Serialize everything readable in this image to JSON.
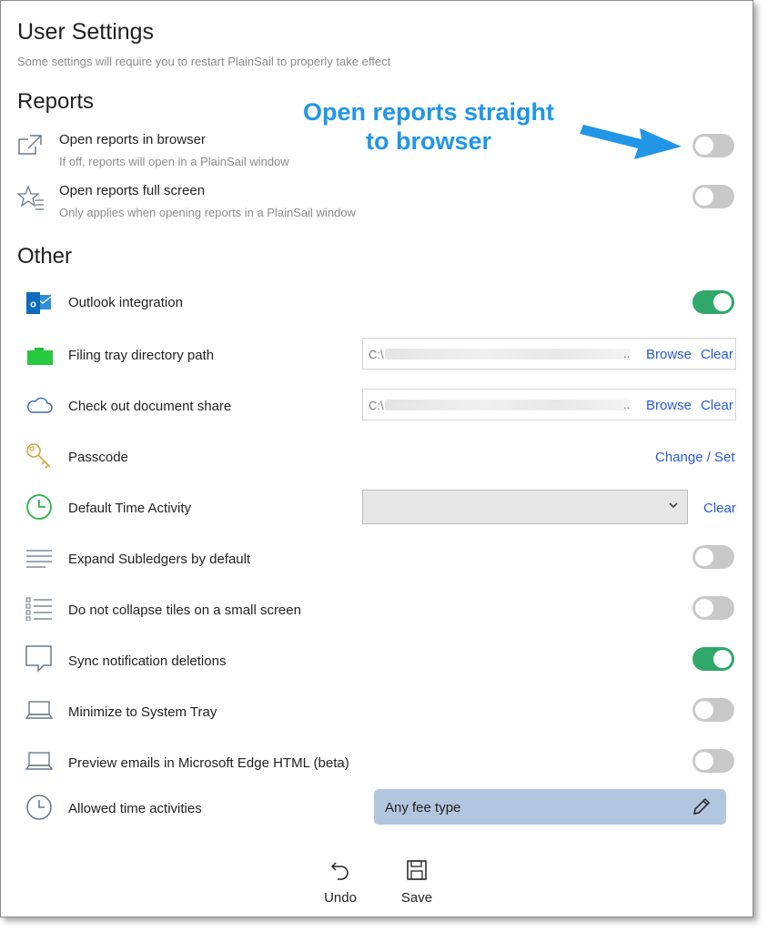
{
  "header": {
    "title": "User Settings",
    "subtitle": "Some settings will require you to restart PlainSail to properly take effect"
  },
  "annotation": {
    "line1": "Open reports straight",
    "line2": "to browser",
    "color": "#2196e6"
  },
  "sections": {
    "reports": "Reports",
    "other": "Other"
  },
  "reports": {
    "open_in_browser": {
      "label": "Open reports in browser",
      "sub": "If off, reports will open in a PlainSail window",
      "on": false
    },
    "full_screen": {
      "label": "Open reports full screen",
      "sub": "Only applies when opening reports in a PlainSail window",
      "on": false
    }
  },
  "other": {
    "outlook": {
      "label": "Outlook integration",
      "on": true
    },
    "filing_tray": {
      "label": "Filing tray directory path",
      "value": "C:\\",
      "browse": "Browse",
      "clear": "Clear"
    },
    "checkout": {
      "label": "Check out document share",
      "value": "C:\\",
      "browse": "Browse",
      "clear": "Clear"
    },
    "passcode": {
      "label": "Passcode",
      "action": "Change / Set"
    },
    "default_time": {
      "label": "Default Time Activity",
      "value": "",
      "clear": "Clear"
    },
    "expand_subledgers": {
      "label": "Expand Subledgers by default",
      "on": false
    },
    "collapse_tiles": {
      "label": "Do not collapse tiles on a small screen",
      "on": false
    },
    "sync_notifications": {
      "label": "Sync notification deletions",
      "on": true
    },
    "minimize_tray": {
      "label": "Minimize to System Tray",
      "on": false
    },
    "preview_edge": {
      "label": "Preview emails in Microsoft Edge HTML (beta)",
      "on": false
    },
    "allowed_time": {
      "label": "Allowed time activities",
      "value": "Any fee type"
    }
  },
  "footer": {
    "undo": "Undo",
    "save": "Save"
  },
  "colors": {
    "toggle_on": "#2fa86a",
    "toggle_off": "#c8c8c8",
    "link": "#2a5bd7",
    "fee_bg": "#b3c6df"
  }
}
